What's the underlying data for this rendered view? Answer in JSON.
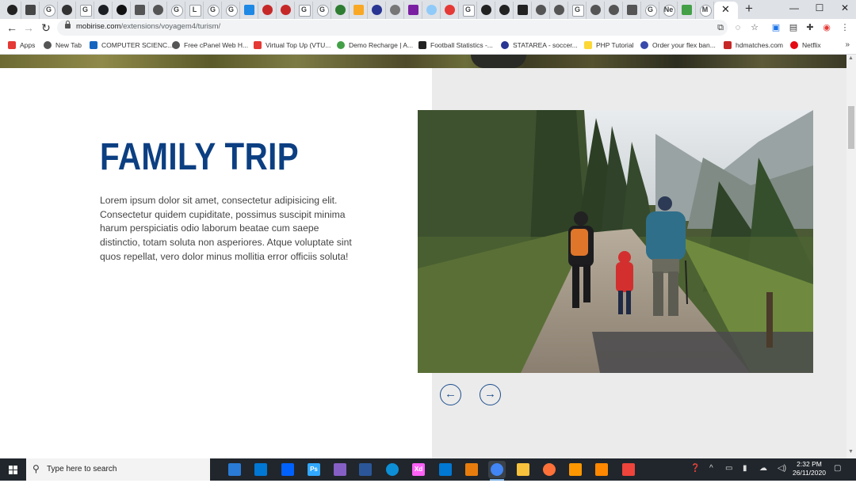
{
  "browser": {
    "tabs": [
      {
        "icon": "circle-dark-icon",
        "color": "#222222"
      },
      {
        "icon": "wordpress-icon",
        "color": "#464646"
      },
      {
        "icon": "google-icon",
        "color": "#ffffff",
        "letter": "G"
      },
      {
        "icon": "square-app-icon",
        "color": "#333333"
      },
      {
        "icon": "google-icon",
        "color": "#ffffff",
        "letter": "G"
      },
      {
        "icon": "github-icon",
        "color": "#1b1f23"
      },
      {
        "icon": "medium-icon",
        "color": "#111111"
      },
      {
        "icon": "globe-icon",
        "color": "#555555"
      },
      {
        "icon": "globe-icon",
        "color": "#555555"
      },
      {
        "icon": "google-icon",
        "color": "#ffffff",
        "letter": "G"
      },
      {
        "icon": "letter-l-icon",
        "color": "#ffffff",
        "letter": "L"
      },
      {
        "icon": "google-icon",
        "color": "#ffffff",
        "letter": "G"
      },
      {
        "icon": "google-icon",
        "color": "#ffffff",
        "letter": "G"
      },
      {
        "icon": "blue-app-icon",
        "color": "#1e88e5"
      },
      {
        "icon": "red-app-icon",
        "color": "#c62828"
      },
      {
        "icon": "red-app-icon",
        "color": "#c62828"
      },
      {
        "icon": "google-icon",
        "color": "#ffffff",
        "letter": "G"
      },
      {
        "icon": "google-icon",
        "color": "#ffffff",
        "letter": "G"
      },
      {
        "icon": "link-icon",
        "color": "#2e7d32"
      },
      {
        "icon": "circle-yellow-icon",
        "color": "#f9a825"
      },
      {
        "icon": "dark-app-icon",
        "color": "#283593"
      },
      {
        "icon": "cart-icon",
        "color": "#777777"
      },
      {
        "icon": "purple-app-icon",
        "color": "#7b1fa2"
      },
      {
        "icon": "wave-app-icon",
        "color": "#90caf9"
      },
      {
        "icon": "youtube-icon",
        "color": "#e53935"
      },
      {
        "icon": "google-icon",
        "color": "#ffffff",
        "letter": "G"
      },
      {
        "icon": "bw-app-icon",
        "color": "#222222"
      },
      {
        "icon": "bw-app-icon",
        "color": "#222222"
      },
      {
        "icon": "bw-app-icon",
        "color": "#222222"
      },
      {
        "icon": "globe-icon",
        "color": "#555555"
      },
      {
        "icon": "globe-icon",
        "color": "#555555"
      },
      {
        "icon": "google-icon",
        "color": "#ffffff",
        "letter": "G"
      },
      {
        "icon": "cap-icon",
        "color": "#555555"
      },
      {
        "icon": "globe-icon",
        "color": "#555555"
      },
      {
        "icon": "globe-icon",
        "color": "#555555"
      },
      {
        "icon": "google-icon",
        "color": "#ffffff",
        "letter": "G"
      },
      {
        "icon": "text-tab-icon",
        "color": "#ffffff",
        "letter": "Ne"
      },
      {
        "icon": "green-app-icon",
        "color": "#43a047"
      },
      {
        "icon": "gmail-icon",
        "color": "#ffffff",
        "letter": "M"
      }
    ],
    "new_tab_glyph": "+",
    "window_controls": {
      "minimize": "—",
      "maximize": "☐",
      "close": "✕"
    },
    "address": {
      "host": "mobirise.com",
      "path": "/extensions/voyagem4/turism/"
    },
    "bookmarks": [
      {
        "label": "Apps",
        "color": "#e53935"
      },
      {
        "label": "New Tab",
        "color": "#555555"
      },
      {
        "label": "COMPUTER SCIENC...",
        "color": "#1565c0"
      },
      {
        "label": "Free cPanel Web H...",
        "color": "#555555"
      },
      {
        "label": "Virtual Top Up (VTU...",
        "color": "#e53935"
      },
      {
        "label": "Demo Recharge | A...",
        "color": "#43a047"
      },
      {
        "label": "Football Statistics -...",
        "color": "#222222"
      },
      {
        "label": "STATAREA - soccer...",
        "color": "#283593"
      },
      {
        "label": "PHP Tutorial",
        "color": "#fdd835"
      },
      {
        "label": "Order your flex ban...",
        "color": "#3949ab"
      },
      {
        "label": "hdmatches.com",
        "color": "#c62828"
      },
      {
        "label": "Netflix",
        "color": "#e50914"
      }
    ],
    "bookmarks_more": "»"
  },
  "page": {
    "section_title": "FAMILY TRIP",
    "section_body": "Lorem ipsum dolor sit amet, consectetur adipisicing elit. Consectetur quidem cupiditate, possimus suscipit minima harum perspiciatis odio laborum beatae cum saepe distinctio, totam soluta non asperiores. Atque voluptate sint quos repellat, vero dolor minus mollitia error officiis soluta!",
    "prev_label": "←",
    "next_label": "→",
    "accent_color": "#0c3f82"
  },
  "taskbar": {
    "search_placeholder": "Type here to search",
    "apps": [
      {
        "icon": "task-view-icon",
        "color": "#2a7bd5"
      },
      {
        "icon": "store-icon",
        "color": "#0078d4"
      },
      {
        "icon": "dropbox-icon",
        "color": "#0061fe"
      },
      {
        "icon": "photoshop-icon",
        "color": "#31a8ff",
        "letter": "Ps"
      },
      {
        "icon": "visual-studio-icon",
        "color": "#865fc5"
      },
      {
        "icon": "word-icon",
        "color": "#2b579a"
      },
      {
        "icon": "edge-icon",
        "color": "#0c8fd6"
      },
      {
        "icon": "adobe-xd-icon",
        "color": "#ff61f6",
        "letter": "Xd"
      },
      {
        "icon": "mail-icon",
        "color": "#0078d4"
      },
      {
        "icon": "blender-icon",
        "color": "#e87d0d"
      },
      {
        "icon": "chrome-icon",
        "color": "#4285f4"
      },
      {
        "icon": "file-explorer-icon",
        "color": "#f9c23c"
      },
      {
        "icon": "firefox-icon",
        "color": "#ff7139"
      },
      {
        "icon": "sublime-icon",
        "color": "#ff9800"
      },
      {
        "icon": "vlc-icon",
        "color": "#ff8800"
      },
      {
        "icon": "anydesk-icon",
        "color": "#ef443b"
      }
    ],
    "time": "2:32 PM",
    "date": "26/11/2020"
  }
}
